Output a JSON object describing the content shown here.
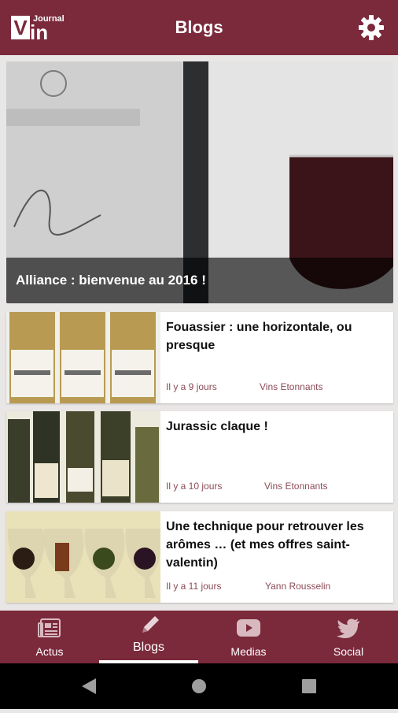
{
  "header": {
    "logo_text_top": "Journal",
    "logo_text_v": "V",
    "logo_text_in": "in",
    "title": "Blogs"
  },
  "hero": {
    "title": "Alliance : bienvenue au 2016 !"
  },
  "articles": [
    {
      "title": "Fouassier : une horizontale, ou presque",
      "date": "Il y a 9 jours",
      "author": "Vins Etonnants"
    },
    {
      "title": "Jurassic claque !",
      "date": "Il y a 10 jours",
      "author": "Vins Etonnants"
    },
    {
      "title": "Une technique pour retrouver les arômes … (et mes offres saint-valentin)",
      "date": "Il y a 11 jours",
      "author": "Yann Rousselin"
    }
  ],
  "nav": {
    "items": [
      {
        "label": "Actus",
        "icon": "newspaper-icon"
      },
      {
        "label": "Blogs",
        "icon": "pencil-icon",
        "active": true
      },
      {
        "label": "Medias",
        "icon": "youtube-icon"
      },
      {
        "label": "Social",
        "icon": "twitter-icon"
      }
    ]
  },
  "colors": {
    "brand": "#7a2a3b",
    "meta": "#8b4a57"
  }
}
